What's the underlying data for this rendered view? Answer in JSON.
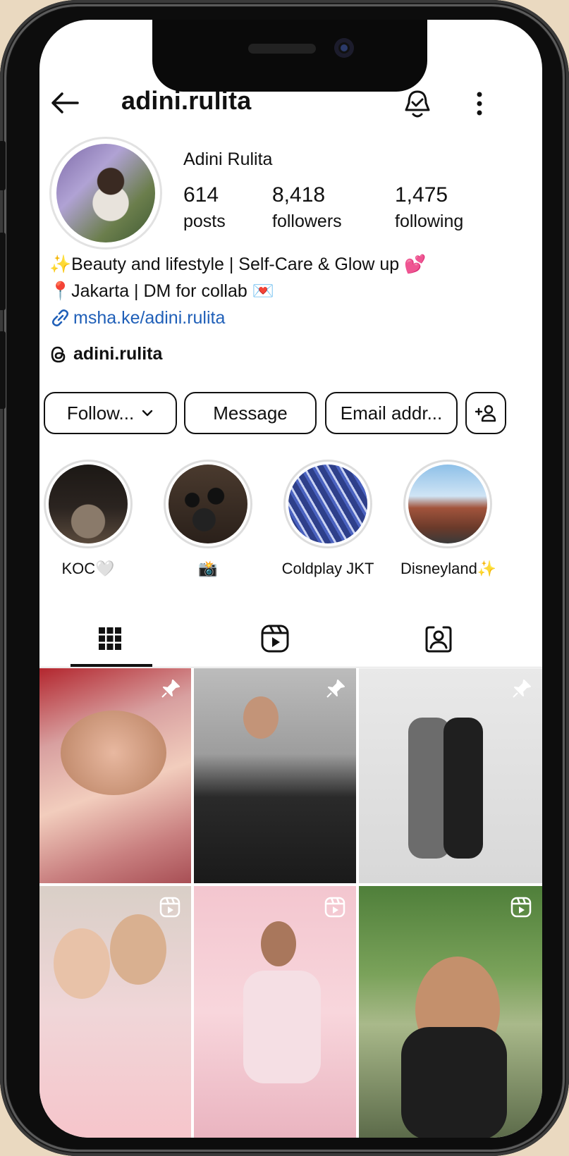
{
  "header": {
    "username": "adini.rulita",
    "back_icon": "arrow-left-icon",
    "bell_icon": "bell-check-icon",
    "more_icon": "more-vertical-icon"
  },
  "profile": {
    "display_name": "Adini Rulita",
    "stats": [
      {
        "value": "614",
        "label": "posts"
      },
      {
        "value": "8,418",
        "label": "followers"
      },
      {
        "value": "1,475",
        "label": "following"
      }
    ],
    "bio": [
      "✨Beauty and lifestyle | Self-Care & Glow up 💕",
      "📍Jakarta | DM for collab 💌"
    ],
    "link": "msha.ke/adini.rulita",
    "threads_handle": "adini.rulita"
  },
  "actions": {
    "follow_label": "Follow...",
    "message_label": "Message",
    "email_label": "Email addr...",
    "add_person_icon": "add-person-icon"
  },
  "highlights": [
    {
      "label": "KOC🤍"
    },
    {
      "label": "📸"
    },
    {
      "label": "Coldplay JKT"
    },
    {
      "label": "Disneyland✨"
    }
  ],
  "tabs": [
    {
      "name": "grid",
      "icon": "grid-icon",
      "active": true
    },
    {
      "name": "reels",
      "icon": "reels-icon",
      "active": false
    },
    {
      "name": "tagged",
      "icon": "tagged-person-icon",
      "active": false
    }
  ],
  "colors": {
    "link": "#1f5fb8",
    "background_outer": "#ead9c0",
    "text": "#111111"
  }
}
